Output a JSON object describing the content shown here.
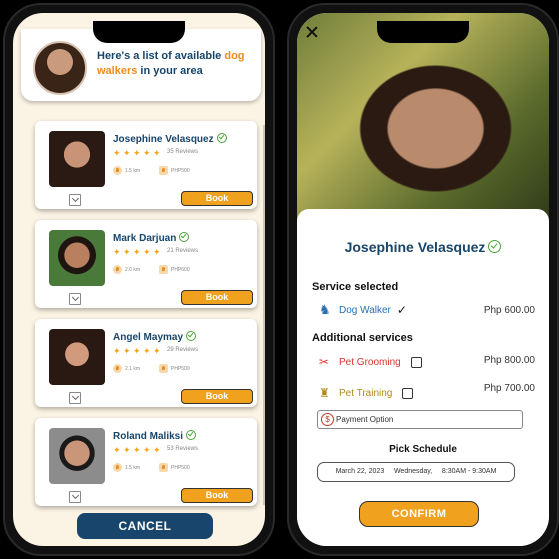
{
  "list_screen": {
    "header": {
      "text_before": "Here's a list of available ",
      "highlight": "dog walkers",
      "text_after": " in your area"
    },
    "walkers": [
      {
        "name": "Josephine Velasquez",
        "reviews": "35 Reviews",
        "distance": "1.5 km",
        "price": "PHP500",
        "book_label": "Book",
        "rating": 5
      },
      {
        "name": "Mark Darjuan",
        "reviews": "21 Reviews",
        "distance": "2.0 km",
        "price": "PHP600",
        "book_label": "Book",
        "rating": 5
      },
      {
        "name": "Angel Maymay",
        "reviews": "29 Reviews",
        "distance": "2.1 km",
        "price": "PHP500",
        "book_label": "Book",
        "rating": 5
      },
      {
        "name": "Roland Maliksi",
        "reviews": "53 Reviews",
        "distance": "1.5 km",
        "price": "PHP500",
        "book_label": "Book",
        "rating": 5
      }
    ],
    "cancel_label": "CANCEL"
  },
  "detail_screen": {
    "name": "Josephine Velasquez",
    "service_selected_title": "Service selected",
    "service": {
      "label": "Dog Walker",
      "price": "Php 600.00"
    },
    "additional_title": "Additional services",
    "additional": [
      {
        "label": "Pet Grooming",
        "price": "Php 800.00"
      },
      {
        "label": "Pet Training",
        "price": "Php 700.00"
      }
    ],
    "payment_placeholder": "Payment Option",
    "pick_schedule_title": "Pick Schedule",
    "schedule": "March 22, 2023     Wednesday,     8:30AM - 9:30AM",
    "confirm_label": "CONFIRM"
  },
  "colors": {
    "brand_blue": "#17456b",
    "accent_orange": "#f0a21f",
    "verified_green": "#4aa13a",
    "service_red": "#d9342b"
  },
  "icons": {
    "rating": "bone-icon",
    "verified": "verified-check-icon",
    "close": "close-icon",
    "payment": "dollar-icon"
  }
}
